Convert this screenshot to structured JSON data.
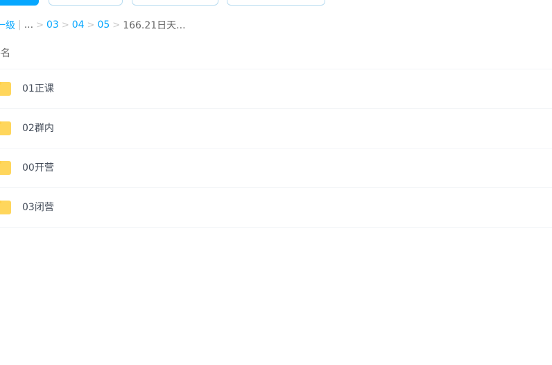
{
  "breadcrumb": {
    "parent_label": "一级",
    "bar": "|",
    "more": "...",
    "sep": ">",
    "items": [
      "03",
      "04",
      "05"
    ],
    "current": "166.21日天..."
  },
  "list_header": {
    "name_column": "件名"
  },
  "files": [
    {
      "name": "01正课",
      "icon": "folder-icon"
    },
    {
      "name": "02群内",
      "icon": "folder-icon"
    },
    {
      "name": "00开营",
      "icon": "folder-icon"
    },
    {
      "name": "03闭营",
      "icon": "folder-icon"
    }
  ],
  "colors": {
    "accent": "#06a7ff",
    "folder": "#ffd65c",
    "divider": "#f2f4f7"
  }
}
